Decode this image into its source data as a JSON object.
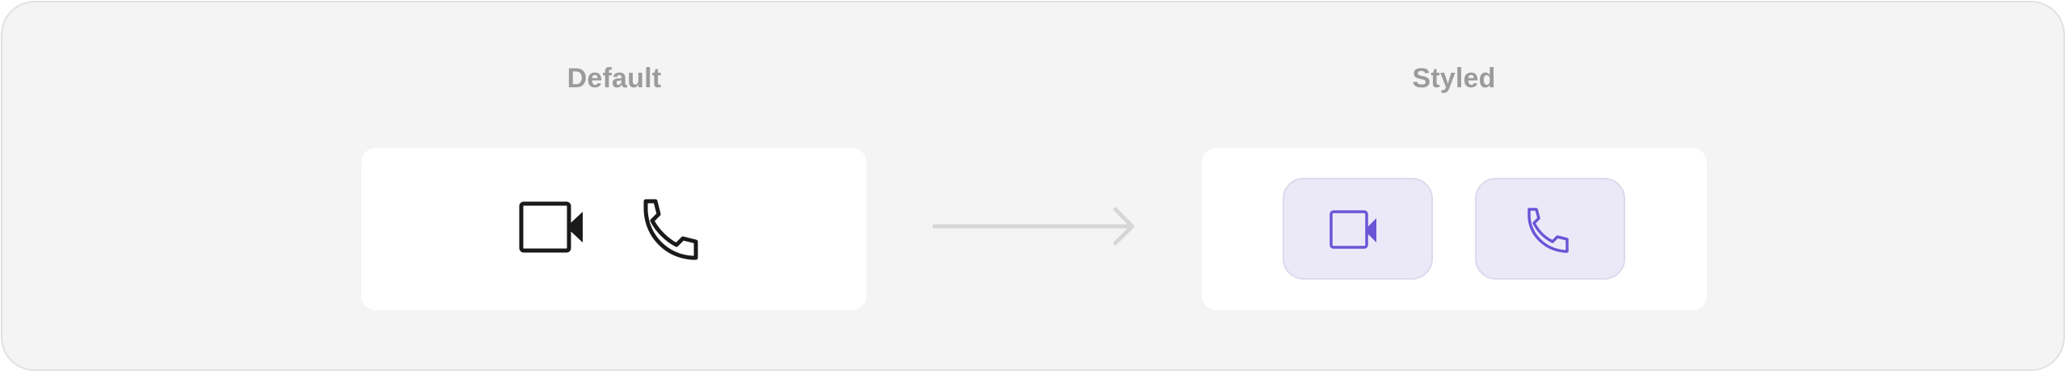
{
  "demo": {
    "default_label": "Default",
    "styled_label": "Styled"
  },
  "icons": {
    "video": "video-camera-icon",
    "phone": "phone-icon",
    "arrow": "arrow-right-icon"
  },
  "colors": {
    "default_icon": "#1a1a1a",
    "styled_icon": "#6a55d6",
    "styled_button_bg": "#ebe9f8",
    "panel_bg": "#f4f4f4",
    "label": "#9b9b9b"
  }
}
